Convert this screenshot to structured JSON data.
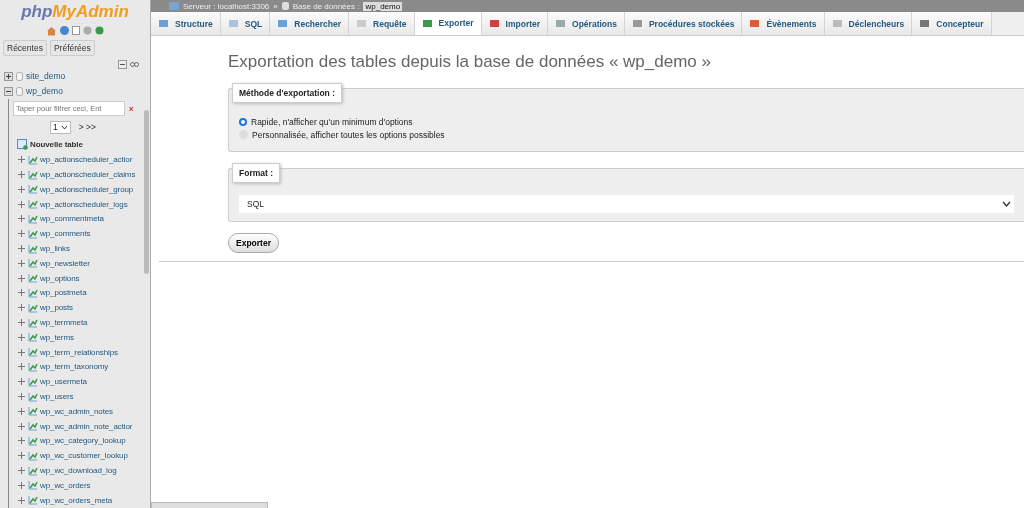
{
  "logo": {
    "php": "php",
    "name": "MyAdmin"
  },
  "sidebar": {
    "nav_tabs": [
      "Récentes",
      "Préférées"
    ],
    "databases": [
      {
        "name": "site_demo",
        "expanded": false
      },
      {
        "name": "wp_demo",
        "expanded": true,
        "filter": {
          "placeholder": "Taper pour filtrer ceci, Ent",
          "clear": "x"
        },
        "page": "1",
        "page_nav": "> >>",
        "new_table": "Nouvelle table",
        "tables": [
          {
            "name": "wp_actionscheduler_actior",
            "expanded": false
          },
          {
            "name": "wp_actionscheduler_claims",
            "expanded": false
          },
          {
            "name": "wp_actionscheduler_group",
            "expanded": false
          },
          {
            "name": "wp_actionscheduler_logs",
            "expanded": false
          },
          {
            "name": "wp_commentmeta",
            "expanded": false
          },
          {
            "name": "wp_comments",
            "expanded": false
          },
          {
            "name": "wp_links",
            "expanded": false
          },
          {
            "name": "wp_newsletter",
            "expanded": false
          },
          {
            "name": "wp_options",
            "expanded": false
          },
          {
            "name": "wp_postmeta",
            "expanded": false
          },
          {
            "name": "wp_posts",
            "expanded": false
          },
          {
            "name": "wp_termmeta",
            "expanded": false
          },
          {
            "name": "wp_terms",
            "expanded": false
          },
          {
            "name": "wp_term_relationships",
            "expanded": false
          },
          {
            "name": "wp_term_taxonomy",
            "expanded": false
          },
          {
            "name": "wp_usermeta",
            "expanded": false
          },
          {
            "name": "wp_users",
            "expanded": false
          },
          {
            "name": "wp_wc_admin_notes",
            "expanded": false
          },
          {
            "name": "wp_wc_admin_note_actior",
            "expanded": false
          },
          {
            "name": "wp_wc_category_lookup",
            "expanded": false
          },
          {
            "name": "wp_wc_customer_lookup",
            "expanded": false
          },
          {
            "name": "wp_wc_download_log",
            "expanded": false
          },
          {
            "name": "wp_wc_orders",
            "expanded": false
          },
          {
            "name": "wp_wc_orders_meta",
            "expanded": false
          }
        ]
      }
    ]
  },
  "breadcrumb": {
    "server": "Serveur : localhost:3306",
    "separator": "»",
    "database_label": "Base de données :",
    "database": "wp_demo"
  },
  "tabs": [
    {
      "label": "Structure",
      "selected": false
    },
    {
      "label": "SQL",
      "selected": false
    },
    {
      "label": "Rechercher",
      "selected": false
    },
    {
      "label": "Requête",
      "selected": false
    },
    {
      "label": "Exporter",
      "selected": true
    },
    {
      "label": "Importer",
      "selected": false
    },
    {
      "label": "Opérations",
      "selected": false
    },
    {
      "label": "Procédures stockées",
      "selected": false
    },
    {
      "label": "Évènements",
      "selected": false
    },
    {
      "label": "Déclencheurs",
      "selected": false
    },
    {
      "label": "Concepteur",
      "selected": false
    }
  ],
  "title": "Exportation des tables depuis la base de données « wp_demo »",
  "method": {
    "legend": "Méthode d'exportation :",
    "options": [
      {
        "label": "Rapide, n'afficher qu'un minimum d'options",
        "selected": true
      },
      {
        "label": "Personnalisée, afficher toutes les options possibles",
        "selected": false
      }
    ]
  },
  "format": {
    "legend": "Format :",
    "value": "SQL"
  },
  "export_button": "Exporter"
}
